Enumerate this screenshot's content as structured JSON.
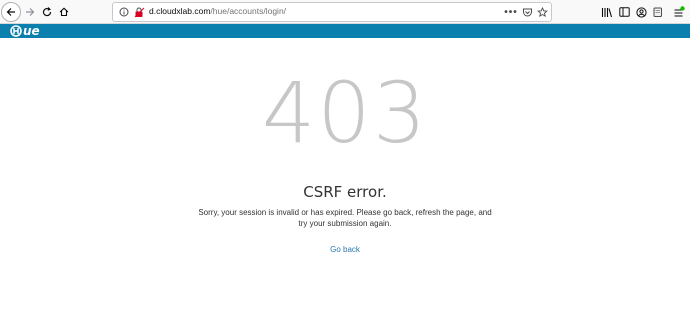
{
  "browser": {
    "url_host": "d.cloudxlab.com",
    "url_path": "/hue/accounts/login/",
    "icons": [
      "back-icon",
      "forward-icon",
      "reload-icon",
      "home-icon",
      "info-icon",
      "tracking-protection-icon",
      "page-actions-icon",
      "pocket-icon",
      "bookmark-star-icon",
      "library-icon",
      "sidebar-icon",
      "account-icon",
      "extension-icon",
      "menu-icon"
    ]
  },
  "hue": {
    "logo_text": "ue"
  },
  "error": {
    "code": "403",
    "title": "CSRF error.",
    "description": "Sorry, your session is invalid or has expired. Please go back, refresh the page, and try your submission again.",
    "go_back": "Go back"
  },
  "colors": {
    "hue_bar": "#0b7fad",
    "error_code": "#c7c7c7",
    "link": "#2a78b0"
  }
}
